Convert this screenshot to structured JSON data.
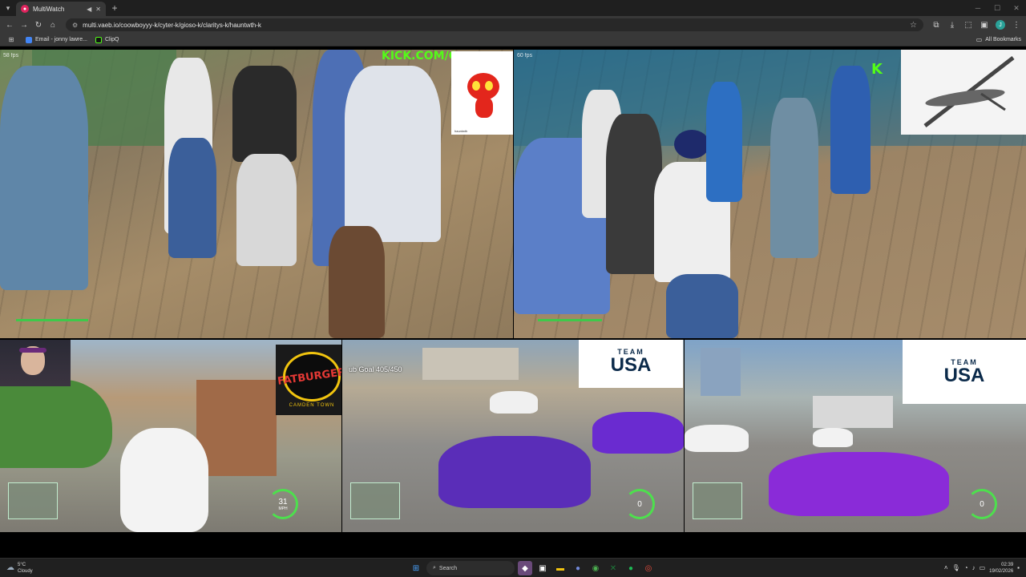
{
  "browser": {
    "tab": {
      "title": "MultiWatch",
      "favicon": "multiwatch-favicon"
    },
    "url": "multi.vaeb.io/coowboyyy-k/cyter-k/gioso-k/claritys-k/hauntwth-k",
    "bookmarks": [
      {
        "label": "Email - jonny lawre...",
        "icon": "chrome-icon"
      },
      {
        "label": "ClipQ",
        "icon": "clipq-icon"
      }
    ],
    "all_bookmarks": "All Bookmarks"
  },
  "streams": {
    "top_left": {
      "fps": "58 fps",
      "overlay": "KICK.COM/C",
      "devil_caption": "hauntwth"
    },
    "top_right": {
      "fps": "60 fps",
      "overlay": "K"
    },
    "bottom_left": {
      "brand": "FATBURGER",
      "brand_sub": "CAMDEN TOWN",
      "speed": "31",
      "speed_unit": "MPH"
    },
    "bottom_middle": {
      "sub_goal": "ub Goal 405/450",
      "team_line1": "TEAM",
      "team_line2": "USA",
      "speed": "0"
    },
    "bottom_right": {
      "team_line1": "TEAM",
      "team_line2": "USA",
      "speed": "0"
    }
  },
  "taskbar": {
    "weather_temp": "5°C",
    "weather_desc": "Cloudy",
    "search_label": "Search",
    "time": "02:39",
    "date": "19/02/2026"
  },
  "colors": {
    "kick_green": "#53fc18",
    "hud_green": "#3ec94a",
    "car_purple": "#6a2bd0"
  }
}
